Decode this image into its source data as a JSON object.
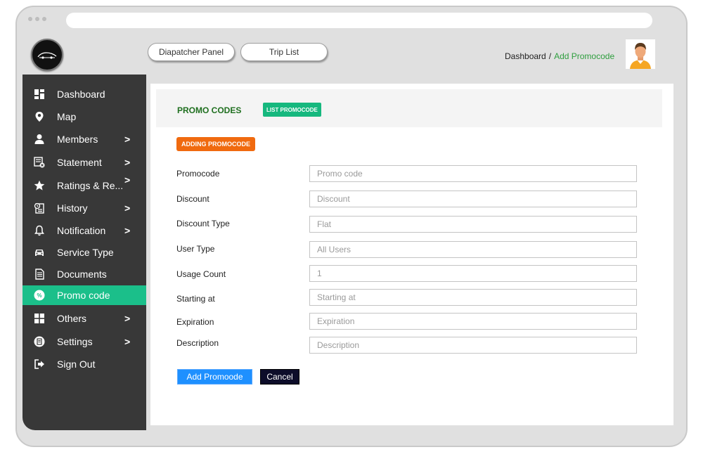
{
  "header": {
    "dispatcher_label": "Diapatcher Panel",
    "trip_list_label": "Trip List",
    "breadcrumb": {
      "root": "Dashboard",
      "separator": "/",
      "current": "Add Promocode"
    }
  },
  "sidebar": {
    "items": [
      {
        "label": "Dashboard",
        "icon": "dashboard-icon"
      },
      {
        "label": "Map",
        "icon": "map-pin-icon"
      },
      {
        "label": "Members",
        "icon": "user-icon",
        "chevron": ">"
      },
      {
        "label": "Statement",
        "icon": "statement-icon",
        "chevron": ">"
      },
      {
        "label": "Ratings & Re...",
        "icon": "star-icon",
        "chevron": ">"
      },
      {
        "label": "History",
        "icon": "history-icon",
        "chevron": ">"
      },
      {
        "label": "Notification",
        "icon": "bell-icon",
        "chevron": ">"
      },
      {
        "label": "Service Type",
        "icon": "car-icon"
      },
      {
        "label": "Documents",
        "icon": "document-icon"
      },
      {
        "label": "Promo code",
        "icon": "percent-icon",
        "active": true
      },
      {
        "label": "Others",
        "icon": "grid-icon",
        "chevron": ">"
      },
      {
        "label": "Settings",
        "icon": "settings-icon",
        "chevron": ">"
      },
      {
        "label": "Sign Out",
        "icon": "sign-out-icon"
      }
    ]
  },
  "panel": {
    "title": "PROMO CODES",
    "list_button": "LIST PROMOCODE",
    "adding_badge": "ADDING PROMOCODE"
  },
  "form": {
    "fields": [
      {
        "label": "Promocode",
        "placeholder": "Promo code"
      },
      {
        "label": "Discount",
        "placeholder": "Discount"
      },
      {
        "label": "Discount Type",
        "placeholder": "Flat"
      },
      {
        "label": "User Type",
        "placeholder": "All Users"
      },
      {
        "label": "Usage Count",
        "placeholder": "1"
      },
      {
        "label": "Starting at",
        "placeholder": "Starting at"
      },
      {
        "label": "Expiration",
        "placeholder": "Expiration"
      },
      {
        "label": "Description",
        "placeholder": "Description"
      }
    ],
    "submit_label": "Add Promoode",
    "cancel_label": "Cancel"
  },
  "colors": {
    "sidebar_bg": "#383838",
    "active_item": "#1bbf8a",
    "title_green": "#1f6f1f",
    "list_button_bg": "#16b87e",
    "adding_badge_bg": "#f06a0f",
    "submit_bg": "#1e90ff",
    "cancel_bg": "#0d0d2a",
    "breadcrumb_current": "#2e9e3e"
  }
}
